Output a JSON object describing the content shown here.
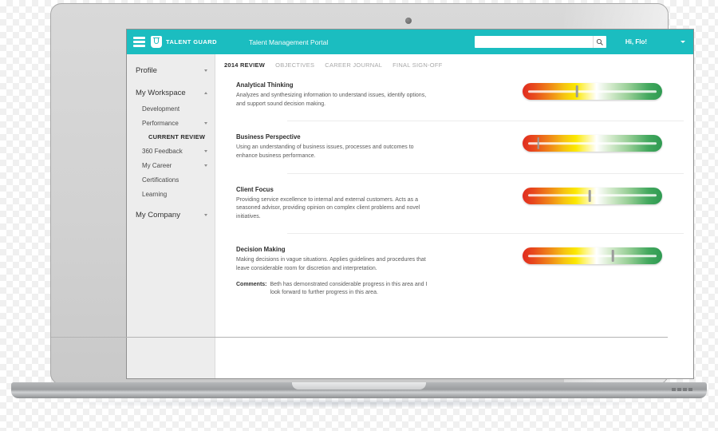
{
  "header": {
    "menu_icon": "hamburger-menu-icon",
    "logo_icon": "talentguard-shield-icon",
    "brand": "TALENT GUARD",
    "portal_title": "Talent Management Portal",
    "search": {
      "value": "",
      "placeholder": "",
      "icon": "search-icon"
    },
    "greeting": "Hi, Flo!",
    "user_caret_icon": "chevron-down-icon",
    "accent_color": "#1BBDC0"
  },
  "sidebar": {
    "background_color": "#EDEDED",
    "items": [
      {
        "label": "Profile",
        "level": "top",
        "caret": "down"
      },
      {
        "label": "My Workspace",
        "level": "top",
        "caret": "up"
      },
      {
        "label": "Development",
        "level": "sub",
        "caret": "none"
      },
      {
        "label": "Performance",
        "level": "sub",
        "caret": "down"
      },
      {
        "label": "CURRENT REVIEW",
        "level": "current",
        "caret": "none"
      },
      {
        "label": "360 Feedback",
        "level": "sub",
        "caret": "down"
      },
      {
        "label": "My Career",
        "level": "sub",
        "caret": "down"
      },
      {
        "label": "Certifications",
        "level": "sub",
        "caret": "none"
      },
      {
        "label": "Learning",
        "level": "sub",
        "caret": "none"
      },
      {
        "label": "My Company",
        "level": "top",
        "caret": "down"
      }
    ]
  },
  "main": {
    "tabs": [
      {
        "label": "2014 REVIEW",
        "active": true
      },
      {
        "label": "OBJECTIVES",
        "active": false
      },
      {
        "label": "CAREER JOURNAL",
        "active": false
      },
      {
        "label": "FINAL SIGN-OFF",
        "active": false
      }
    ],
    "competencies": [
      {
        "title": "Analytical Thinking",
        "description": "Analyzes and synthesizing information to understand issues, identify options, and support sound decision making.",
        "rating_percent": 38
      },
      {
        "title": "Business Perspective",
        "description": "Using an understanding of business issues, processes and outcomes to enhance business performance.",
        "rating_percent": 8
      },
      {
        "title": "Client Focus",
        "description": "Providing service excellence to internal and external customers. Acts as a seasoned advisor, providing opinion on complex client problems and novel initiatives.",
        "rating_percent": 48
      },
      {
        "title": "Decision Making",
        "description": "Making decisions in vague situations. Applies guidelines and procedures that leave considerable room for discretion and interpretation.",
        "rating_percent": 66,
        "comments_label": "Comments:",
        "comments_text": "Beth has demonstrated considerable progress in this area and I look forward to further progress in this area."
      }
    ]
  }
}
